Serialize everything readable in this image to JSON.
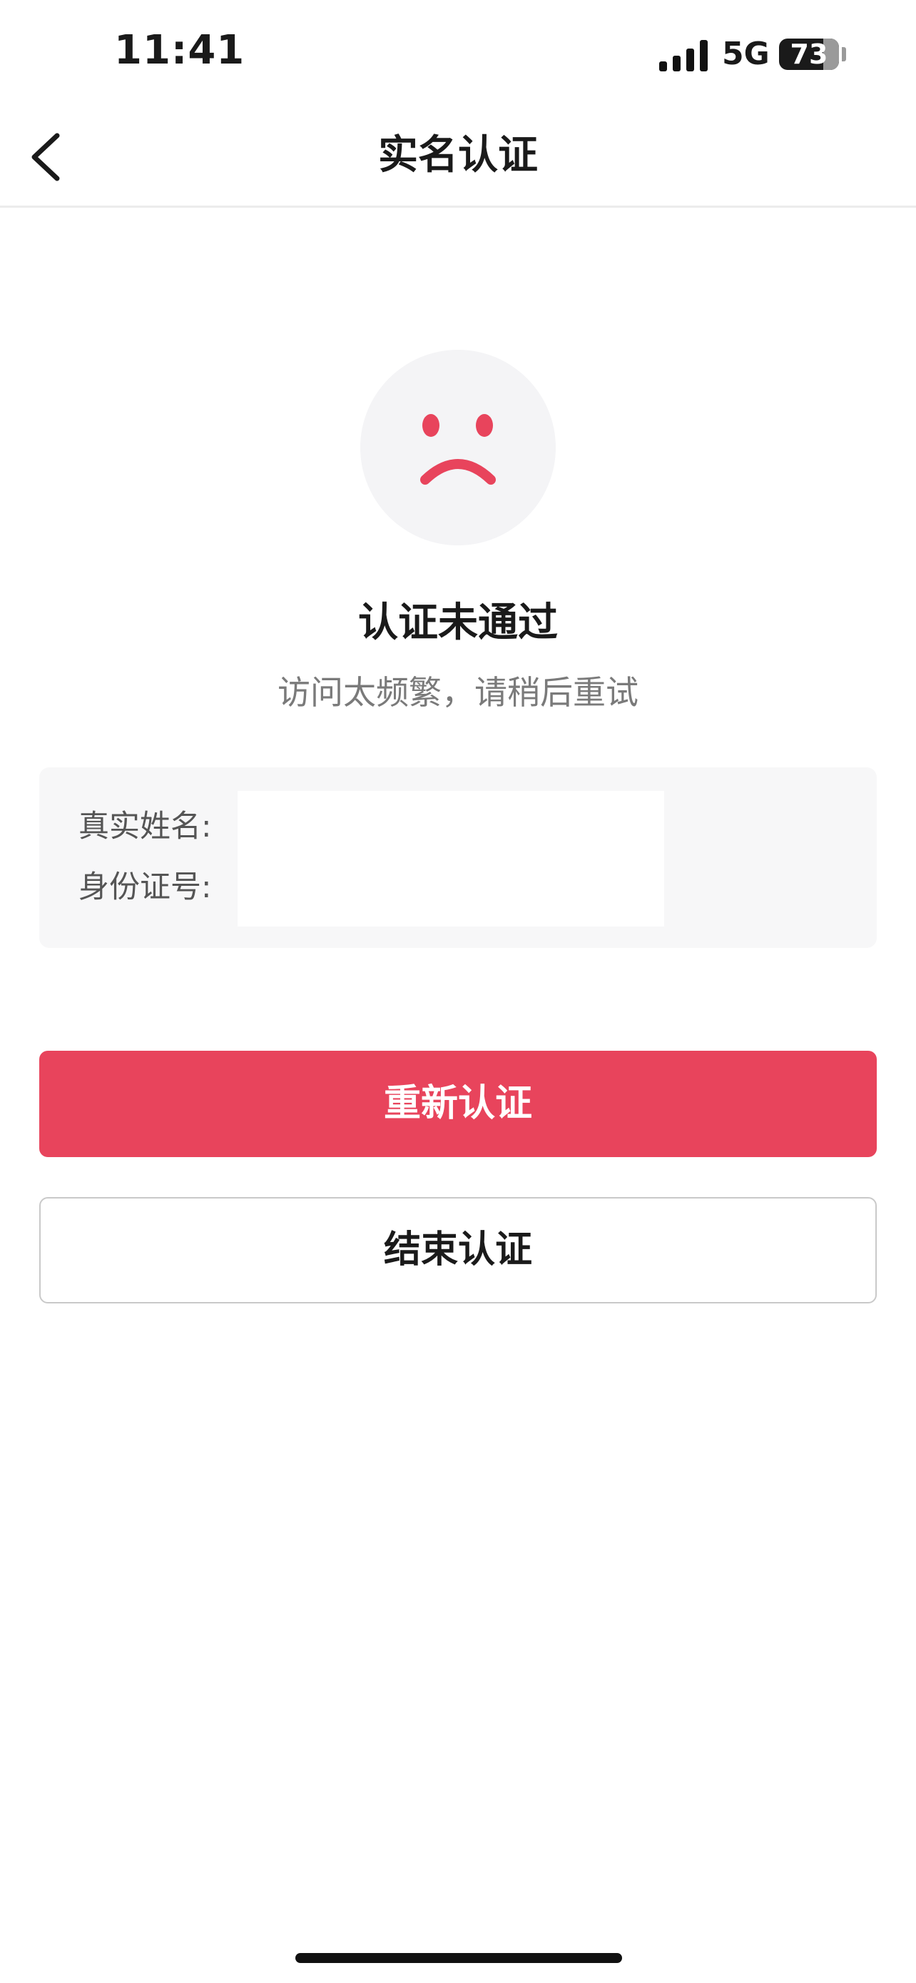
{
  "status_bar": {
    "time": "11:41",
    "network": "5G",
    "battery": "73"
  },
  "nav": {
    "title": "实名认证",
    "back_icon": "chevron-left-icon"
  },
  "result": {
    "icon": "sad-face-icon",
    "title": "认证未通过",
    "message": "访问太频繁，请稍后重试"
  },
  "info": {
    "name_label": "真实姓名:",
    "id_label": "身份证号:"
  },
  "actions": {
    "retry_label": "重新认证",
    "end_label": "结束认证"
  },
  "colors": {
    "accent": "#e8445c",
    "icon_bg": "#f4f4f6",
    "card_bg": "#f7f7f8"
  }
}
